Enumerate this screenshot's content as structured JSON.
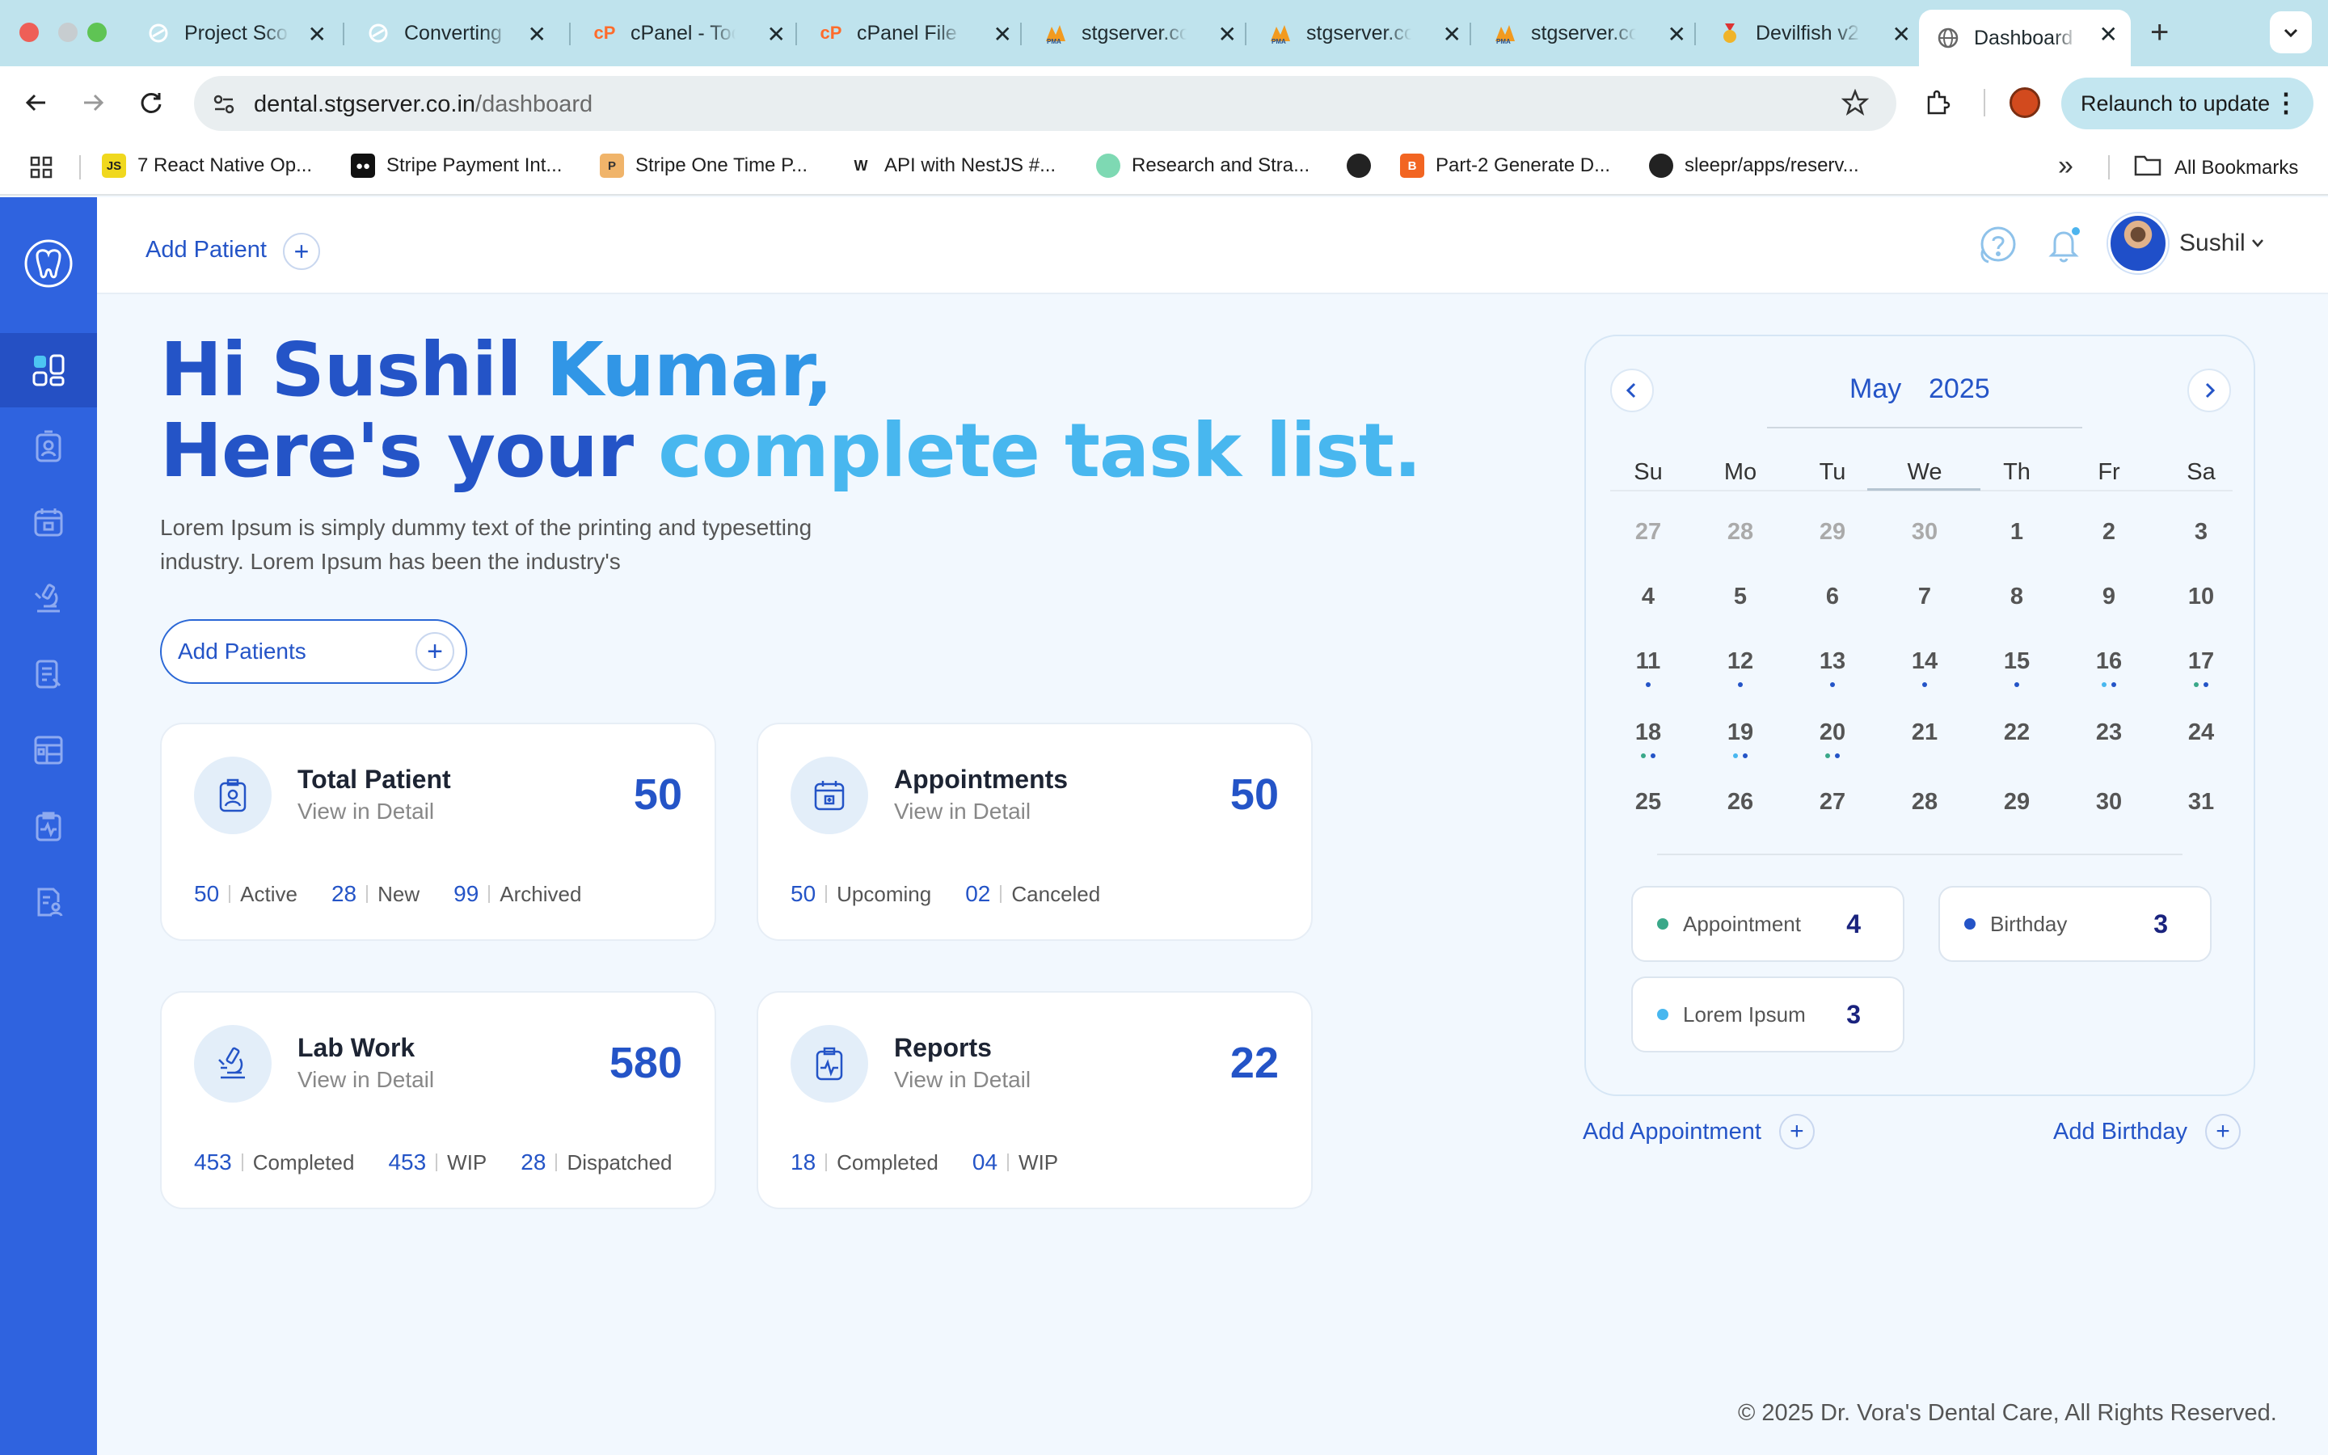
{
  "browser": {
    "tabs": [
      {
        "label": "Project Scope",
        "favicon": "sync-circle-icon"
      },
      {
        "label": "Converting",
        "favicon": "sync-circle-icon"
      },
      {
        "label": "cPanel - Tools",
        "favicon": "cpanel-icon"
      },
      {
        "label": "cPanel File Manager",
        "favicon": "cpanel-icon"
      },
      {
        "label": "stgserver.co.in",
        "favicon": "phpmyadmin-icon"
      },
      {
        "label": "stgserver.co.in",
        "favicon": "phpmyadmin-icon"
      },
      {
        "label": "stgserver.co.in",
        "favicon": "phpmyadmin-icon"
      },
      {
        "label": "Devilfish v2",
        "favicon": "medal-icon"
      },
      {
        "label": "Dashboard",
        "favicon": "globe-icon",
        "active": true
      }
    ],
    "address": {
      "host": "dental.stgserver.co.in",
      "path": "/dashboard"
    },
    "relaunch_label": "Relaunch to update",
    "bookmarks": [
      {
        "label": "7 React Native Op...",
        "icon": "js-icon"
      },
      {
        "label": "Stripe Payment Int...",
        "icon": "medium-icon"
      },
      {
        "label": "Stripe One Time P...",
        "icon": "p-icon"
      },
      {
        "label": "API with NestJS #...",
        "icon": "w-icon"
      },
      {
        "label": "Research and Stra...",
        "icon": "leaf-icon"
      },
      {
        "label": "",
        "icon": "globe-icon"
      },
      {
        "label": "Part-2 Generate D...",
        "icon": "blogger-icon"
      },
      {
        "label": "sleepr/apps/reserv...",
        "icon": "github-icon"
      }
    ],
    "all_bookmarks_label": "All Bookmarks"
  },
  "topbar": {
    "add_patient_label": "Add Patient",
    "user_name": "Sushil"
  },
  "hero": {
    "greeting_part1": "Hi Sushil ",
    "greeting_part2": "Kumar,",
    "line2_part1": "Here's your ",
    "line2_part2": "complete task list.",
    "description": "Lorem Ipsum is simply dummy text of the printing and typesetting industry. Lorem Ipsum has been the industry's",
    "add_patients_label": "Add Patients"
  },
  "cards": [
    {
      "title": "Total Patient",
      "subtitle": "View in Detail",
      "total": "50",
      "icon": "patient-id-icon",
      "stats": [
        {
          "value": "50",
          "label": "Active"
        },
        {
          "value": "28",
          "label": "New"
        },
        {
          "value": "99",
          "label": "Archived"
        }
      ]
    },
    {
      "title": "Appointments",
      "subtitle": "View in Detail",
      "total": "50",
      "icon": "calendar-icon",
      "stats": [
        {
          "value": "50",
          "label": "Upcoming"
        },
        {
          "value": "02",
          "label": "Canceled"
        }
      ]
    },
    {
      "title": "Lab Work",
      "subtitle": "View in Detail",
      "total": "580",
      "icon": "microscope-icon",
      "stats": [
        {
          "value": "453",
          "label": "Completed"
        },
        {
          "value": "453",
          "label": "WIP"
        },
        {
          "value": "28",
          "label": "Dispatched"
        }
      ]
    },
    {
      "title": "Reports",
      "subtitle": "View in Detail",
      "total": "22",
      "icon": "clipboard-pulse-icon",
      "stats": [
        {
          "value": "18",
          "label": "Completed"
        },
        {
          "value": "04",
          "label": "WIP"
        }
      ]
    }
  ],
  "calendar": {
    "month": "May",
    "year": "2025",
    "weekdays": [
      "Su",
      "Mo",
      "Tu",
      "We",
      "Th",
      "Fr",
      "Sa"
    ],
    "weeks": [
      [
        {
          "d": "27",
          "muted": true
        },
        {
          "d": "28",
          "muted": true
        },
        {
          "d": "29",
          "muted": true
        },
        {
          "d": "30",
          "muted": true
        },
        {
          "d": "1"
        },
        {
          "d": "2"
        },
        {
          "d": "3"
        }
      ],
      [
        {
          "d": "4"
        },
        {
          "d": "5"
        },
        {
          "d": "6"
        },
        {
          "d": "7"
        },
        {
          "d": "8"
        },
        {
          "d": "9"
        },
        {
          "d": "10"
        }
      ],
      [
        {
          "d": "11",
          "dots": [
            "#2454c7"
          ]
        },
        {
          "d": "12",
          "dots": [
            "#2454c7"
          ]
        },
        {
          "d": "13",
          "dots": [
            "#2454c7"
          ]
        },
        {
          "d": "14",
          "dots": [
            "#2454c7"
          ]
        },
        {
          "d": "15",
          "dots": [
            "#2454c7"
          ]
        },
        {
          "d": "16",
          "dots": [
            "#48b7ef",
            "#2454c7"
          ]
        },
        {
          "d": "17",
          "dots": [
            "#3aa889",
            "#2454c7"
          ]
        }
      ],
      [
        {
          "d": "18",
          "dots": [
            "#3aa889",
            "#2454c7"
          ]
        },
        {
          "d": "19",
          "dots": [
            "#48b7ef",
            "#2454c7"
          ]
        },
        {
          "d": "20",
          "dots": [
            "#3aa889",
            "#2454c7"
          ]
        },
        {
          "d": "21"
        },
        {
          "d": "22"
        },
        {
          "d": "23"
        },
        {
          "d": "24"
        }
      ],
      [
        {
          "d": "25"
        },
        {
          "d": "26"
        },
        {
          "d": "27"
        },
        {
          "d": "28"
        },
        {
          "d": "29"
        },
        {
          "d": "30"
        },
        {
          "d": "31"
        }
      ]
    ],
    "legend": [
      {
        "label": "Appointment",
        "count": "4",
        "color": "#3aa889"
      },
      {
        "label": "Birthday",
        "count": "3",
        "color": "#2454c7"
      },
      {
        "label": "Lorem Ipsum",
        "count": "3",
        "color": "#48b7ef"
      }
    ],
    "add_appointment_label": "Add Appointment",
    "add_birthday_label": "Add Birthday"
  },
  "sidebar": {
    "items": [
      {
        "icon": "tooth-logo-icon"
      },
      {
        "icon": "dashboard-grid-icon",
        "active": true
      },
      {
        "icon": "patient-badge-icon"
      },
      {
        "icon": "calendar-icon"
      },
      {
        "icon": "microscope-icon"
      },
      {
        "icon": "document-icon"
      },
      {
        "icon": "table-icon"
      },
      {
        "icon": "clipboard-pulse-icon"
      },
      {
        "icon": "report-user-icon"
      }
    ]
  },
  "footer": "© 2025 Dr. Vora's Dental Care, All Rights Reserved.",
  "colors": {
    "primary": "#2454c7",
    "sidebar": "#2f63df",
    "light_blue": "#48b7ef",
    "teal": "#3aa889",
    "background": "#f2f8fe"
  }
}
